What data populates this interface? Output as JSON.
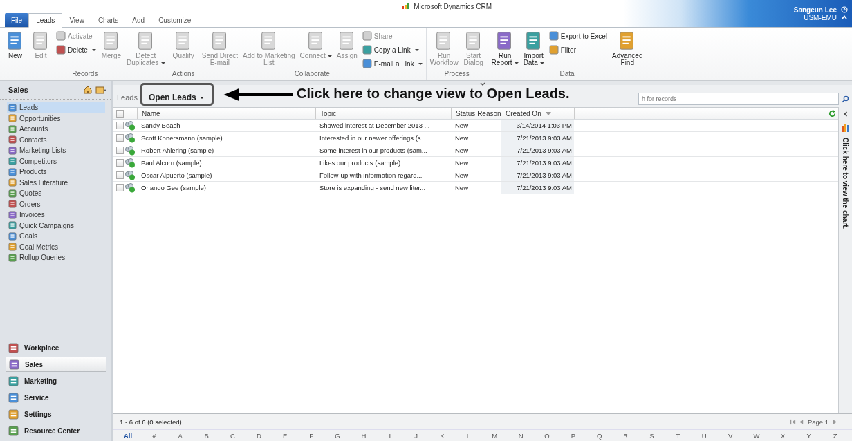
{
  "window": {
    "title": "Microsoft Dynamics CRM"
  },
  "user": {
    "name": "Sangeun Lee",
    "org": "USM-EMU"
  },
  "tabs": [
    {
      "label": "File",
      "kind": "file",
      "selected": false
    },
    {
      "label": "Leads",
      "kind": "tab",
      "selected": true
    },
    {
      "label": "View",
      "kind": "tab",
      "selected": false
    },
    {
      "label": "Charts",
      "kind": "tab",
      "selected": false
    },
    {
      "label": "Add",
      "kind": "tab",
      "selected": false
    },
    {
      "label": "Customize",
      "kind": "tab",
      "selected": false
    }
  ],
  "ribbon": [
    {
      "label": "Records",
      "items": [
        {
          "kind": "large",
          "label": "New",
          "disabled": false,
          "dropdown": false
        },
        {
          "kind": "large",
          "label": "Edit",
          "disabled": true,
          "dropdown": false
        },
        {
          "kind": "stack",
          "items": [
            {
              "label": "Activate",
              "disabled": true,
              "dropdown": false
            },
            {
              "label": "Delete",
              "disabled": false,
              "dropdown": true
            }
          ]
        },
        {
          "kind": "large",
          "label": "Merge",
          "disabled": true,
          "dropdown": false
        },
        {
          "kind": "large",
          "label": "Detect\nDuplicates",
          "disabled": true,
          "dropdown": true
        }
      ]
    },
    {
      "label": "Actions",
      "items": [
        {
          "kind": "large",
          "label": "Qualify",
          "disabled": true,
          "dropdown": false
        }
      ]
    },
    {
      "label": "Collaborate",
      "items": [
        {
          "kind": "large",
          "label": "Send Direct\nE-mail",
          "disabled": true,
          "dropdown": false
        },
        {
          "kind": "large",
          "label": "Add to Marketing\nList",
          "disabled": true,
          "dropdown": false
        },
        {
          "kind": "large",
          "label": "Connect",
          "disabled": true,
          "dropdown": true
        },
        {
          "kind": "large",
          "label": "Assign",
          "disabled": true,
          "dropdown": false
        },
        {
          "kind": "stack",
          "items": [
            {
              "label": "Share",
              "disabled": true,
              "dropdown": false
            },
            {
              "label": "Copy a Link",
              "disabled": false,
              "dropdown": true
            },
            {
              "label": "E-mail a Link",
              "disabled": false,
              "dropdown": true
            }
          ]
        }
      ]
    },
    {
      "label": "Process",
      "items": [
        {
          "kind": "large",
          "label": "Run\nWorkflow",
          "disabled": true,
          "dropdown": false
        },
        {
          "kind": "large",
          "label": "Start\nDialog",
          "disabled": true,
          "dropdown": false
        }
      ]
    },
    {
      "label": "Data",
      "items": [
        {
          "kind": "large",
          "label": "Run\nReport",
          "disabled": false,
          "dropdown": true
        },
        {
          "kind": "large",
          "label": "Import\nData",
          "disabled": false,
          "dropdown": true
        },
        {
          "kind": "stack",
          "items": [
            {
              "label": "Export to Excel",
              "disabled": false,
              "dropdown": false
            },
            {
              "label": "Filter",
              "disabled": false,
              "dropdown": false
            }
          ]
        },
        {
          "kind": "large",
          "label": "Advanced\nFind",
          "disabled": false,
          "dropdown": false
        }
      ]
    }
  ],
  "sidebar": {
    "title": "Sales",
    "items": [
      {
        "label": "Leads",
        "selected": true
      },
      {
        "label": "Opportunities",
        "selected": false
      },
      {
        "label": "Accounts",
        "selected": false
      },
      {
        "label": "Contacts",
        "selected": false
      },
      {
        "label": "Marketing Lists",
        "selected": false
      },
      {
        "label": "Competitors",
        "selected": false
      },
      {
        "label": "Products",
        "selected": false
      },
      {
        "label": "Sales Literature",
        "selected": false
      },
      {
        "label": "Quotes",
        "selected": false
      },
      {
        "label": "Orders",
        "selected": false
      },
      {
        "label": "Invoices",
        "selected": false
      },
      {
        "label": "Quick Campaigns",
        "selected": false
      },
      {
        "label": "Goals",
        "selected": false
      },
      {
        "label": "Goal Metrics",
        "selected": false
      },
      {
        "label": "Rollup Queries",
        "selected": false
      }
    ],
    "modules": [
      {
        "label": "Workplace",
        "selected": false
      },
      {
        "label": "Sales",
        "selected": true
      },
      {
        "label": "Marketing",
        "selected": false
      },
      {
        "label": "Service",
        "selected": false
      },
      {
        "label": "Settings",
        "selected": false
      },
      {
        "label": "Resource Center",
        "selected": false
      }
    ]
  },
  "view": {
    "entity": "Leads",
    "name": "Open Leads",
    "search": {
      "placeholder": "h for records"
    }
  },
  "annotation": {
    "text": "Click here to change view to Open Leads."
  },
  "table": {
    "all_checked": false,
    "columns": [
      "Name",
      "Topic",
      "Status Reason",
      "Created On"
    ],
    "rows": [
      {
        "checked": false,
        "cells": [
          "Sandy Beach",
          "Showed interest at December 2013 ...",
          "New",
          "3/14/2014 1:03 PM"
        ]
      },
      {
        "checked": false,
        "cells": [
          "Scott Konersmann (sample)",
          "Interested in our newer offerings (s...",
          "New",
          "7/21/2013 9:03 AM"
        ]
      },
      {
        "checked": false,
        "cells": [
          "Robert Ahlering (sample)",
          "Some interest in our products (sam...",
          "New",
          "7/21/2013 9:03 AM"
        ]
      },
      {
        "checked": false,
        "cells": [
          "Paul Alcorn (sample)",
          "Likes our products (sample)",
          "New",
          "7/21/2013 9:03 AM"
        ]
      },
      {
        "checked": false,
        "cells": [
          "Oscar Alpuerto (sample)",
          "Follow-up with information regard...",
          "New",
          "7/21/2013 9:03 AM"
        ]
      },
      {
        "checked": false,
        "cells": [
          "Orlando Gee (sample)",
          "Store is expanding - send new liter...",
          "New",
          "7/21/2013 9:03 AM"
        ]
      }
    ]
  },
  "chart_pane": {
    "label": "Click here to view the chart."
  },
  "status_bar": {
    "count": "1 - 6 of 6 (0 selected)",
    "page": "Page 1"
  },
  "alphabet": [
    {
      "label": "All",
      "selected": true
    },
    {
      "label": "#",
      "selected": false
    },
    {
      "label": "A",
      "selected": false
    },
    {
      "label": "B",
      "selected": false
    },
    {
      "label": "C",
      "selected": false
    },
    {
      "label": "D",
      "selected": false
    },
    {
      "label": "E",
      "selected": false
    },
    {
      "label": "F",
      "selected": false
    },
    {
      "label": "G",
      "selected": false
    },
    {
      "label": "H",
      "selected": false
    },
    {
      "label": "I",
      "selected": false
    },
    {
      "label": "J",
      "selected": false
    },
    {
      "label": "K",
      "selected": false
    },
    {
      "label": "L",
      "selected": false
    },
    {
      "label": "M",
      "selected": false
    },
    {
      "label": "N",
      "selected": false
    },
    {
      "label": "O",
      "selected": false
    },
    {
      "label": "P",
      "selected": false
    },
    {
      "label": "Q",
      "selected": false
    },
    {
      "label": "R",
      "selected": false
    },
    {
      "label": "S",
      "selected": false
    },
    {
      "label": "T",
      "selected": false
    },
    {
      "label": "U",
      "selected": false
    },
    {
      "label": "V",
      "selected": false
    },
    {
      "label": "W",
      "selected": false
    },
    {
      "label": "X",
      "selected": false
    },
    {
      "label": "Y",
      "selected": false
    },
    {
      "label": "Z",
      "selected": false
    }
  ]
}
